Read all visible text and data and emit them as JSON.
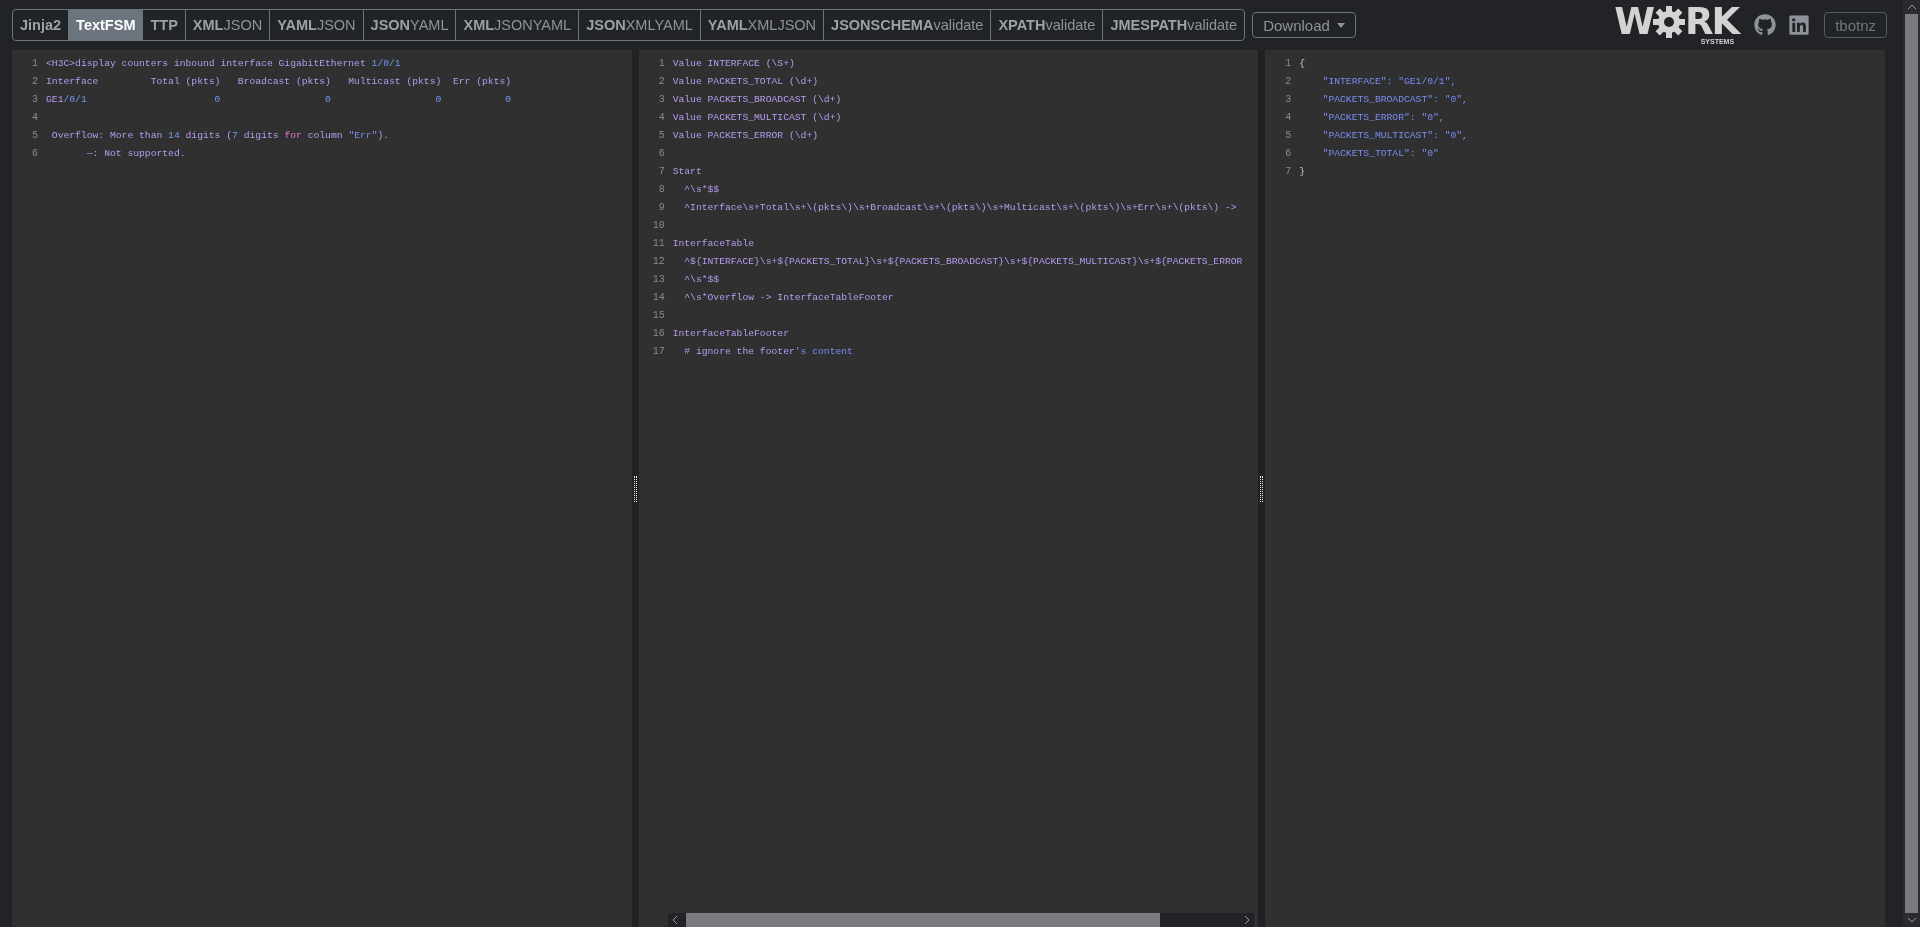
{
  "nav": {
    "tabs": [
      {
        "bold": "Jinja2",
        "selected": false
      },
      {
        "bold": "TextFSM",
        "selected": true
      },
      {
        "bold": "TTP",
        "selected": false
      },
      {
        "bold": "XML",
        "rest": "JSON",
        "selected": false
      },
      {
        "bold": "YAML",
        "rest": "JSON",
        "selected": false
      },
      {
        "bold": "JSON",
        "rest": "YAML",
        "selected": false
      },
      {
        "bold": "XML",
        "rest": "JSONYAML",
        "selected": false
      },
      {
        "bold": "JSON",
        "rest": "XMLYAML",
        "selected": false
      },
      {
        "bold": "YAML",
        "rest": "XMLJSON",
        "selected": false
      },
      {
        "bold": "JSONSCHEMA",
        "rest": "validate",
        "selected": false
      },
      {
        "bold": "XPATH",
        "rest": "validate",
        "selected": false
      },
      {
        "bold": "JMESPATH",
        "rest": "validate",
        "selected": false
      }
    ],
    "download": "Download",
    "logo": {
      "left": "W",
      "right": "RK",
      "sub": "SYSTEMS"
    },
    "user_button": "tbotnz"
  },
  "editors": [
    {
      "kind": "input",
      "lines": [
        {
          "n": "1",
          "parts": [
            {
              "kind": "text",
              "text": "<H3C>display counters inbound interface GigabitEthernet "
            },
            {
              "kind": "num",
              "text": "1/0/1"
            }
          ]
        },
        {
          "n": "2",
          "parts": [
            {
              "kind": "text",
              "text": "Interface         Total (pkts)   Broadcast (pkts)   Multicast (pkts)  Err (pkts)"
            }
          ]
        },
        {
          "n": "3",
          "parts": [
            {
              "kind": "text",
              "text": "GE1"
            },
            {
              "kind": "num",
              "text": "/0/1                      0                  0                  0           0"
            }
          ]
        },
        {
          "n": "4"
        },
        {
          "n": "5",
          "parts": [
            {
              "kind": "text",
              "text": " Overflow: More than "
            },
            {
              "kind": "num",
              "text": "14"
            },
            {
              "kind": "text",
              "text": " digits ("
            },
            {
              "kind": "num",
              "text": "7"
            },
            {
              "kind": "text",
              "text": " digits "
            },
            {
              "kind": "kw",
              "text": "for"
            },
            {
              "kind": "text",
              "text": " column "
            },
            {
              "kind": "str",
              "text": "\"Err\""
            },
            {
              "kind": "text",
              "text": ")."
            }
          ]
        },
        {
          "n": "6",
          "parts": [
            {
              "kind": "text",
              "text": "       —: Not supported."
            }
          ]
        }
      ]
    },
    {
      "kind": "template",
      "lines": [
        {
          "n": "1",
          "parts": [
            {
              "kind": "text",
              "text": "Value INTERFACE (\\S+)"
            }
          ]
        },
        {
          "n": "2",
          "parts": [
            {
              "kind": "text",
              "text": "Value PACKETS_TOTAL (\\d+)"
            }
          ]
        },
        {
          "n": "3",
          "parts": [
            {
              "kind": "text",
              "text": "Value PACKETS_BROADCAST (\\d+)"
            }
          ]
        },
        {
          "n": "4",
          "parts": [
            {
              "kind": "text",
              "text": "Value PACKETS_MULTICAST (\\d+)"
            }
          ]
        },
        {
          "n": "5",
          "parts": [
            {
              "kind": "text",
              "text": "Value PACKETS_ERROR (\\d+)"
            }
          ]
        },
        {
          "n": "6"
        },
        {
          "n": "7",
          "parts": [
            {
              "kind": "text",
              "text": "Start"
            }
          ]
        },
        {
          "n": "8",
          "parts": [
            {
              "kind": "text",
              "text": "  ^\\s*$$"
            }
          ]
        },
        {
          "n": "9",
          "parts": [
            {
              "kind": "text",
              "text": "  ^Interface\\s+Total\\s+\\(pkts\\)\\s+Broadcast\\s+\\(pkts\\)\\s+Multicast\\s+\\(pkts\\)\\s+Err\\s+\\(pkts\\) ->"
            }
          ]
        },
        {
          "n": "10"
        },
        {
          "n": "11",
          "parts": [
            {
              "kind": "text",
              "text": "InterfaceTable"
            }
          ]
        },
        {
          "n": "12",
          "parts": [
            {
              "kind": "text",
              "text": "  ^${INTERFACE}\\s+${PACKETS_TOTAL}\\s+${PACKETS_BROADCAST}\\s+${PACKETS_MULTICAST}\\s+${PACKETS_ERROR"
            }
          ]
        },
        {
          "n": "13",
          "parts": [
            {
              "kind": "text",
              "text": "  ^\\s*$$"
            }
          ]
        },
        {
          "n": "14",
          "parts": [
            {
              "kind": "text",
              "text": "  ^\\s*Overflow -> InterfaceTableFooter"
            }
          ]
        },
        {
          "n": "15"
        },
        {
          "n": "16",
          "parts": [
            {
              "kind": "text",
              "text": "InterfaceTableFooter"
            }
          ]
        },
        {
          "n": "17",
          "parts": [
            {
              "kind": "text",
              "text": "  # ignore the footer"
            },
            {
              "kind": "str",
              "text": "'s content"
            }
          ]
        }
      ]
    },
    {
      "kind": "output",
      "lines": [
        {
          "n": "1",
          "parts": [
            {
              "kind": "punct",
              "text": "{"
            }
          ]
        },
        {
          "n": "2",
          "parts": [
            {
              "kind": "str",
              "text": "    \"INTERFACE\": \"GE1/0/1\","
            }
          ]
        },
        {
          "n": "3",
          "parts": [
            {
              "kind": "str",
              "text": "    \"PACKETS_BROADCAST\": \"0\","
            }
          ]
        },
        {
          "n": "4",
          "parts": [
            {
              "kind": "str",
              "text": "    \"PACKETS_ERROR\": \"0\","
            }
          ]
        },
        {
          "n": "5",
          "parts": [
            {
              "kind": "str",
              "text": "    \"PACKETS_MULTICAST\": \"0\","
            }
          ]
        },
        {
          "n": "6",
          "parts": [
            {
              "kind": "str",
              "text": "    \"PACKETS_TOTAL\": \"0\""
            }
          ]
        },
        {
          "n": "7",
          "parts": [
            {
              "kind": "punct",
              "text": "}"
            }
          ]
        }
      ]
    }
  ]
}
